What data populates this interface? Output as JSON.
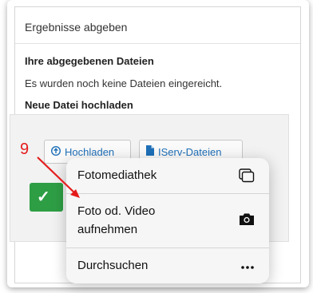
{
  "panel": {
    "title": "Ergebnisse abgeben",
    "submitted_heading": "Ihre abgegebenen Dateien",
    "submitted_status": "Es wurden noch keine Dateien eingereicht.",
    "upload_heading": "Neue Datei hochladen"
  },
  "buttons": {
    "upload": "Hochladen",
    "iserv": "IServ-Dateien",
    "upload_icon": "upload-circle-icon",
    "iserv_icon": "document-icon",
    "confirm_icon": "checkmark-icon"
  },
  "menu": {
    "items": [
      {
        "label": "Fotomediathek",
        "icon": "photo-library-icon"
      },
      {
        "label_line1": "Foto od. Video",
        "label_line2": "aufnehmen",
        "icon": "camera-icon"
      },
      {
        "label": "Durchsuchen",
        "icon": "more-icon"
      }
    ]
  },
  "annotation": {
    "label": "9",
    "color": "#e51b1b"
  },
  "colors": {
    "accent": "#1e6fb8",
    "confirm": "#2e9e45"
  }
}
